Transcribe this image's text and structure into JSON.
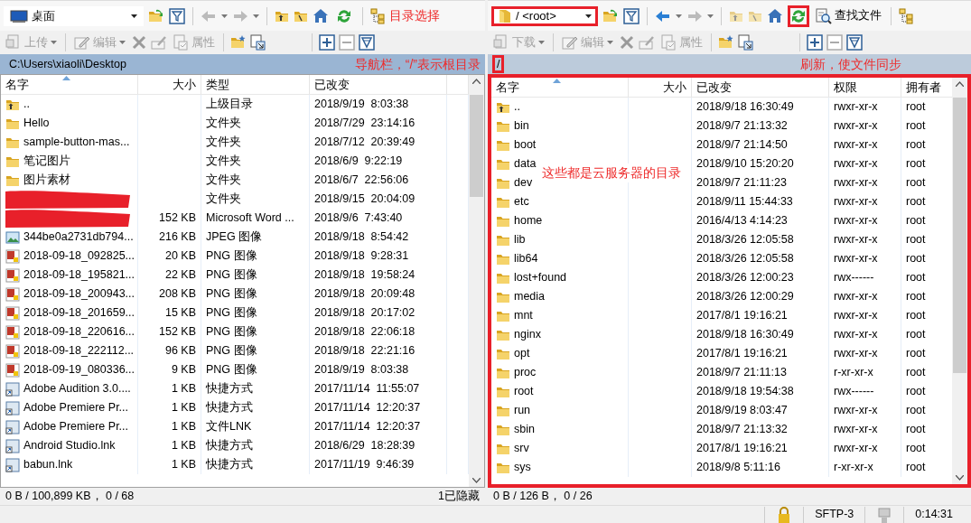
{
  "panes": [
    {
      "kind": "local",
      "drive": {
        "label": "桌面",
        "highlight": false
      },
      "refresh_highlight": false,
      "note": "目录选择",
      "transfer": {
        "label": "上传",
        "disabled": true
      },
      "edit": {
        "label": "编辑",
        "disabled": true
      },
      "properties": {
        "label": "属性",
        "disabled": true
      },
      "path": {
        "text": "C:\\Users\\xiaoli\\Desktop",
        "active": true,
        "highlight": false
      },
      "path_note": "导航栏，“/”表示根目录",
      "columns": [
        {
          "kind": "name",
          "label": "名字",
          "sorted": true
        },
        {
          "kind": "size",
          "label": "大小",
          "sorted": false
        },
        {
          "kind": "type",
          "label": "类型",
          "sorted": false
        },
        {
          "kind": "changed",
          "label": "已改变",
          "sorted": false
        }
      ],
      "list_highlight": false,
      "rows": [
        {
          "kind": "up",
          "name": "..",
          "type": "上级目录",
          "changed": "2018/9/19  8:03:38"
        },
        {
          "kind": "folder",
          "name": "Hello",
          "type": "文件夹",
          "changed": "2018/7/29  23:14:16"
        },
        {
          "kind": "folder",
          "name": "sample-button-mas...",
          "type": "文件夹",
          "changed": "2018/7/12  20:39:49"
        },
        {
          "kind": "folder",
          "name": "笔记图片",
          "type": "文件夹",
          "changed": "2018/6/9  9:22:19"
        },
        {
          "kind": "folder",
          "name": "图片素材",
          "type": "文件夹",
          "changed": "2018/6/7  22:56:06"
        },
        {
          "redacted": true,
          "type": "文件夹",
          "changed": "2018/9/15  20:04:09"
        },
        {
          "redacted": true,
          "size": "152 KB",
          "type": "Microsoft Word ...",
          "changed": "2018/9/6  7:43:40"
        },
        {
          "kind": "jpeg",
          "name": "344be0a2731db794...",
          "size": "216 KB",
          "type": "JPEG 图像",
          "changed": "2018/9/18  8:54:42"
        },
        {
          "kind": "png",
          "name": "2018-09-18_092825...",
          "size": "20 KB",
          "type": "PNG 图像",
          "changed": "2018/9/18  9:28:31"
        },
        {
          "kind": "png",
          "name": "2018-09-18_195821...",
          "size": "22 KB",
          "type": "PNG 图像",
          "changed": "2018/9/18  19:58:24"
        },
        {
          "kind": "png",
          "name": "2018-09-18_200943...",
          "size": "208 KB",
          "type": "PNG 图像",
          "changed": "2018/9/18  20:09:48"
        },
        {
          "kind": "png",
          "name": "2018-09-18_201659...",
          "size": "15 KB",
          "type": "PNG 图像",
          "changed": "2018/9/18  20:17:02"
        },
        {
          "kind": "png",
          "name": "2018-09-18_220616...",
          "size": "152 KB",
          "type": "PNG 图像",
          "changed": "2018/9/18  22:06:18"
        },
        {
          "kind": "png",
          "name": "2018-09-18_222112...",
          "size": "96 KB",
          "type": "PNG 图像",
          "changed": "2018/9/18  22:21:16"
        },
        {
          "kind": "png",
          "name": "2018-09-19_080336...",
          "size": "9 KB",
          "type": "PNG 图像",
          "changed": "2018/9/19  8:03:38"
        },
        {
          "kind": "shortcut",
          "name": "Adobe Audition 3.0....",
          "size": "1 KB",
          "type": "快捷方式",
          "changed": "2017/11/14  11:55:07"
        },
        {
          "kind": "shortcut",
          "name": "Adobe Premiere Pr...",
          "size": "1 KB",
          "type": "快捷方式",
          "changed": "2017/11/14  12:20:37"
        },
        {
          "kind": "shortcut",
          "name": "Adobe Premiere Pr...",
          "size": "1 KB",
          "type": "文件LNK",
          "changed": "2017/11/14  12:20:37"
        },
        {
          "kind": "shortcut",
          "name": "Android Studio.lnk",
          "size": "1 KB",
          "type": "快捷方式",
          "changed": "2018/6/29  18:28:39"
        },
        {
          "kind": "shortcut",
          "name": "babun.lnk",
          "size": "1 KB",
          "type": "快捷方式",
          "changed": "2017/11/19  9:46:39"
        }
      ],
      "status": "0 B / 100,899 KB， 0 / 68",
      "hidden": "1已隐藏"
    },
    {
      "kind": "remote",
      "drive": {
        "label": "/ <root>",
        "highlight": true
      },
      "refresh_highlight": true,
      "find": "查找文件",
      "transfer": {
        "label": "下载",
        "disabled": true
      },
      "edit": {
        "label": "编辑",
        "disabled": true
      },
      "properties": {
        "label": "属性",
        "disabled": true
      },
      "path": {
        "text": "/",
        "active": false,
        "highlight": true
      },
      "path_note": "刷新，使文件同步",
      "columns": [
        {
          "kind": "name",
          "label": "名字",
          "sorted": true
        },
        {
          "kind": "size",
          "label": "大小",
          "sorted": false
        },
        {
          "kind": "changed",
          "label": "已改变",
          "sorted": false
        },
        {
          "kind": "perm",
          "label": "权限",
          "sorted": false
        },
        {
          "kind": "owner",
          "label": "拥有者",
          "sorted": false
        }
      ],
      "list_highlight": true,
      "list_note": "这些都是云服务器的目录",
      "rows": [
        {
          "kind": "up",
          "name": "..",
          "changed": "2018/9/18 16:30:49",
          "perm": "rwxr-xr-x",
          "owner": "root"
        },
        {
          "kind": "folder",
          "name": "bin",
          "changed": "2018/9/7 21:13:32",
          "perm": "rwxr-xr-x",
          "owner": "root"
        },
        {
          "kind": "folder",
          "name": "boot",
          "changed": "2018/9/7 21:14:50",
          "perm": "rwxr-xr-x",
          "owner": "root"
        },
        {
          "kind": "folder",
          "name": "data",
          "changed": "2018/9/10 15:20:20",
          "perm": "rwxr-xr-x",
          "owner": "root"
        },
        {
          "kind": "folder",
          "name": "dev",
          "changed": "2018/9/7 21:11:23",
          "perm": "rwxr-xr-x",
          "owner": "root"
        },
        {
          "kind": "folder",
          "name": "etc",
          "changed": "2018/9/11 15:44:33",
          "perm": "rwxr-xr-x",
          "owner": "root"
        },
        {
          "kind": "folder",
          "name": "home",
          "changed": "2016/4/13 4:14:23",
          "perm": "rwxr-xr-x",
          "owner": "root"
        },
        {
          "kind": "folder",
          "name": "lib",
          "changed": "2018/3/26 12:05:58",
          "perm": "rwxr-xr-x",
          "owner": "root"
        },
        {
          "kind": "folder",
          "name": "lib64",
          "changed": "2018/3/26 12:05:58",
          "perm": "rwxr-xr-x",
          "owner": "root"
        },
        {
          "kind": "folder",
          "name": "lost+found",
          "changed": "2018/3/26 12:00:23",
          "perm": "rwx------",
          "owner": "root"
        },
        {
          "kind": "folder",
          "name": "media",
          "changed": "2018/3/26 12:00:29",
          "perm": "rwxr-xr-x",
          "owner": "root"
        },
        {
          "kind": "folder",
          "name": "mnt",
          "changed": "2017/8/1 19:16:21",
          "perm": "rwxr-xr-x",
          "owner": "root"
        },
        {
          "kind": "folder",
          "name": "nginx",
          "changed": "2018/9/18 16:30:49",
          "perm": "rwxr-xr-x",
          "owner": "root"
        },
        {
          "kind": "folder",
          "name": "opt",
          "changed": "2017/8/1 19:16:21",
          "perm": "rwxr-xr-x",
          "owner": "root"
        },
        {
          "kind": "folder",
          "name": "proc",
          "changed": "2018/9/7 21:11:13",
          "perm": "r-xr-xr-x",
          "owner": "root"
        },
        {
          "kind": "folder",
          "name": "root",
          "changed": "2018/9/18 19:54:38",
          "perm": "rwx------",
          "owner": "root"
        },
        {
          "kind": "folder",
          "name": "run",
          "changed": "2018/9/19 8:03:47",
          "perm": "rwxr-xr-x",
          "owner": "root"
        },
        {
          "kind": "folder",
          "name": "sbin",
          "changed": "2018/9/7 21:13:32",
          "perm": "rwxr-xr-x",
          "owner": "root"
        },
        {
          "kind": "folder",
          "name": "srv",
          "changed": "2017/8/1 19:16:21",
          "perm": "rwxr-xr-x",
          "owner": "root"
        },
        {
          "kind": "folder",
          "name": "sys",
          "changed": "2018/9/8 5:11:16",
          "perm": "r-xr-xr-x",
          "owner": "root"
        }
      ],
      "status": "0 B / 126 B， 0 / 26"
    }
  ],
  "status_bar": {
    "protocol": "SFTP-3",
    "elapsed": "0:14:31"
  }
}
